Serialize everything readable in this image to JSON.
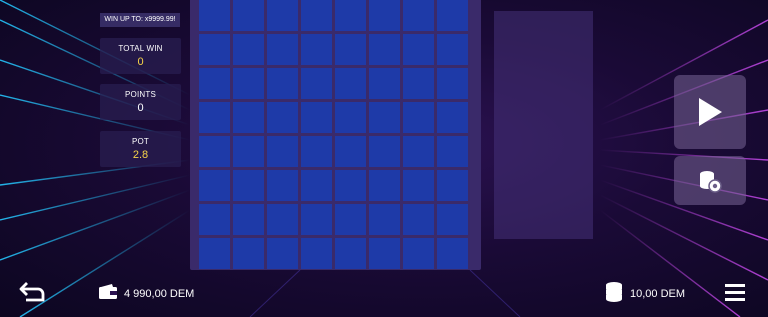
{
  "win_up_to": "WIN UP TO: x9999.99!",
  "stats": {
    "total_win": {
      "label": "TOTAL WIN",
      "value": "0"
    },
    "points": {
      "label": "POINTS",
      "value": "0"
    },
    "pot": {
      "label": "POT",
      "value": "2.8"
    }
  },
  "board": {
    "rows": 8,
    "cols": 8
  },
  "controls": {
    "play_icon": "play-icon",
    "coins_settings_icon": "coins-settings-icon",
    "back_icon": "back-arrow-icon",
    "menu_icon": "menu-icon"
  },
  "footer": {
    "balance": "4 990,00 DEM",
    "bet": "10,00 DEM"
  },
  "colors": {
    "cell": "#1e3aa8",
    "board": "#3a2a6a",
    "accent_yellow": "#f6d448"
  }
}
